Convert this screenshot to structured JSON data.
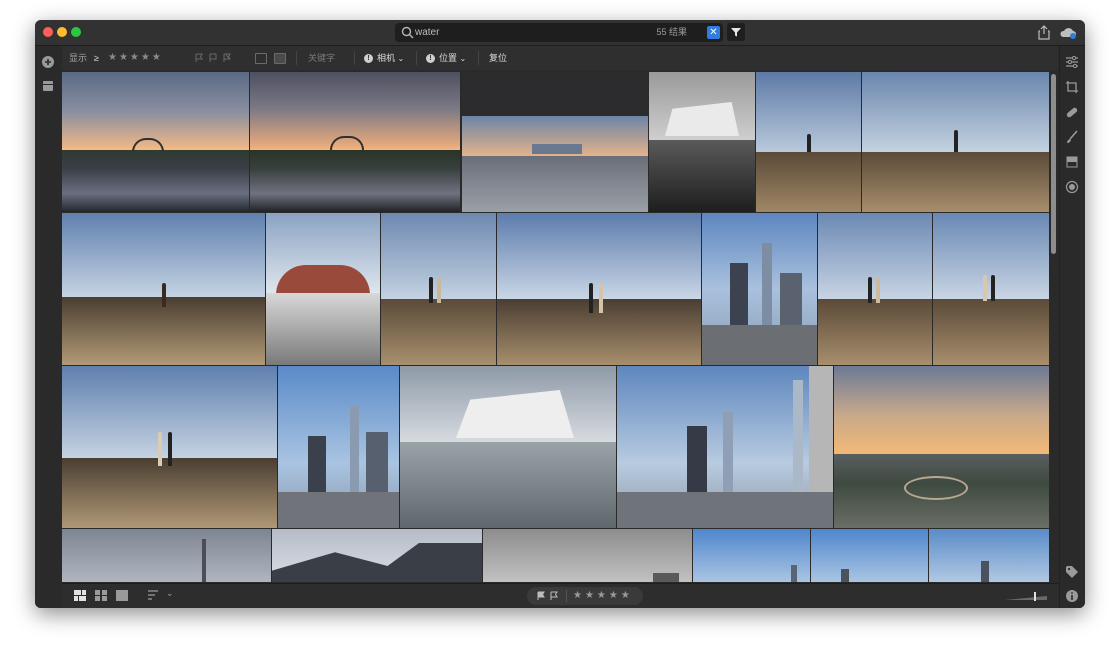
{
  "search": {
    "query": "water",
    "result_count": "55 结果"
  },
  "filter_bar": {
    "show_label": "显示",
    "rating_operator": "≥",
    "stars": "★★★★★",
    "keyword_placeholder": "关键字",
    "camera_label": "相机",
    "location_label": "位置",
    "reset_label": "复位"
  },
  "bottom_bar": {
    "stars": "★★★★★"
  },
  "colors": {
    "accent": "#2f7de1",
    "window_bg": "#2a2a2a",
    "toolbar_bg": "#2f2f2f"
  },
  "icons": {
    "title": [
      "search-icon",
      "clear-icon",
      "filter-icon",
      "share-icon",
      "cloud-sync-icon"
    ],
    "left_rail": [
      "add-photos-icon",
      "library-icon"
    ],
    "right_rail": [
      "edit-sliders-icon",
      "crop-icon",
      "healing-icon",
      "brush-icon",
      "linear-gradient-icon",
      "radial-gradient-icon",
      "keyword-tag-icon",
      "info-icon"
    ],
    "bottom": [
      "square-grid-view-icon",
      "photo-grid-view-icon",
      "detail-view-icon",
      "sort-icon",
      "flag-icon",
      "reject-flag-icon"
    ]
  },
  "photos": [
    {
      "subject": "bridge-sunset-reflection"
    },
    {
      "subject": "bridge-sunset-reflection"
    },
    {
      "subject": "skyline-under-overhang"
    },
    {
      "subject": "modern-building-reflection-bw"
    },
    {
      "subject": "pier-single-person"
    },
    {
      "subject": "pier-single-person"
    },
    {
      "subject": "pier-single-person",
      "selected": true
    },
    {
      "subject": "arched-building"
    },
    {
      "subject": "pier-couple"
    },
    {
      "subject": "pier-couple"
    },
    {
      "subject": "city-skyline-aerial"
    },
    {
      "subject": "pier-couple"
    },
    {
      "subject": "pier-couple"
    },
    {
      "subject": "pier-couple"
    },
    {
      "subject": "city-skyline-aerial"
    },
    {
      "subject": "modern-building-reflection"
    },
    {
      "subject": "city-skyline-aerial"
    },
    {
      "subject": "city-sunset-aerial"
    },
    {
      "subject": "city-tower-cloudy"
    },
    {
      "subject": "modern-building-curved"
    },
    {
      "subject": "gray-cityscape"
    },
    {
      "subject": "city-skyline-blue"
    },
    {
      "subject": "city-skyline-blue"
    },
    {
      "subject": "city-skyline-blue"
    }
  ]
}
